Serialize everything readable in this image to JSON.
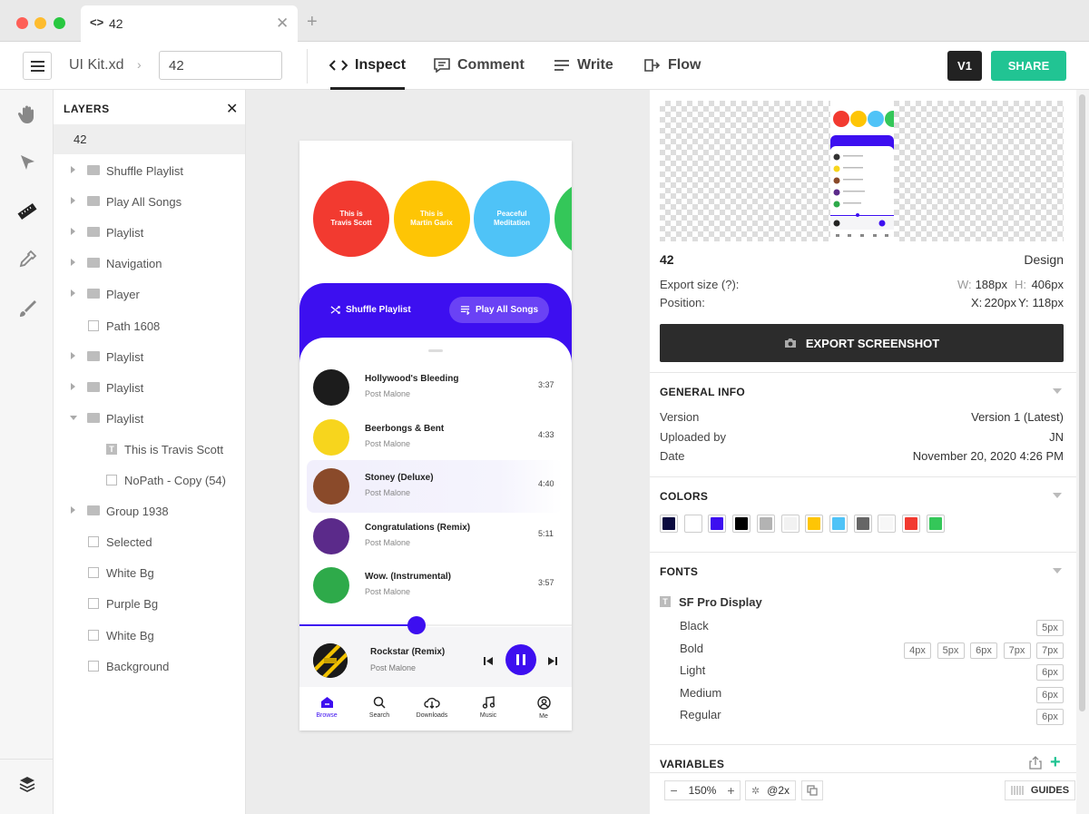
{
  "browser_tab": {
    "title": "42"
  },
  "toolbar": {
    "file_name": "UI Kit.xd",
    "artboard_value": "42",
    "nav": [
      "Inspect",
      "Comment",
      "Write",
      "Flow"
    ],
    "version": "V1",
    "share": "SHARE"
  },
  "layers": {
    "title": "LAYERS",
    "root": "42",
    "items": [
      {
        "label": "Shuffle Playlist",
        "type": "folder",
        "expand": "collapsed",
        "indent": 0
      },
      {
        "label": "Play All Songs",
        "type": "folder",
        "expand": "collapsed",
        "indent": 0
      },
      {
        "label": "Playlist",
        "type": "folder",
        "expand": "collapsed",
        "indent": 0
      },
      {
        "label": "Navigation",
        "type": "folder",
        "expand": "collapsed",
        "indent": 0
      },
      {
        "label": "Player",
        "type": "folder",
        "expand": "collapsed",
        "indent": 0
      },
      {
        "label": "Path 1608",
        "type": "path",
        "expand": "none",
        "indent": 0
      },
      {
        "label": "Playlist",
        "type": "folder",
        "expand": "collapsed",
        "indent": 0
      },
      {
        "label": "Playlist",
        "type": "folder",
        "expand": "collapsed",
        "indent": 0
      },
      {
        "label": "Playlist",
        "type": "folder",
        "expand": "expanded",
        "indent": 0
      },
      {
        "label": "This is Travis Scott",
        "type": "text",
        "expand": "none",
        "indent": 1
      },
      {
        "label": "NoPath - Copy (54)",
        "type": "path",
        "expand": "none",
        "indent": 1
      },
      {
        "label": "Group 1938",
        "type": "folder",
        "expand": "collapsed",
        "indent": 0
      },
      {
        "label": "Selected",
        "type": "path",
        "expand": "none",
        "indent": 0
      },
      {
        "label": "White Bg",
        "type": "path",
        "expand": "none",
        "indent": 0
      },
      {
        "label": "Purple Bg",
        "type": "path",
        "expand": "none",
        "indent": 0
      },
      {
        "label": "White Bg",
        "type": "path",
        "expand": "none",
        "indent": 0
      },
      {
        "label": "Background",
        "type": "path",
        "expand": "none",
        "indent": 0
      }
    ]
  },
  "phone": {
    "playlists": [
      {
        "label": "This is\nTravis Scott",
        "color": "#f23a30"
      },
      {
        "label": "This is\nMartin Garix",
        "color": "#fec505"
      },
      {
        "label": "Peaceful\nMeditation",
        "color": "#4fc3f7"
      },
      {
        "label": "",
        "color": "#34c759"
      }
    ],
    "shuffle": "Shuffle Playlist",
    "play_all": "Play All Songs",
    "songs": [
      {
        "name": "Hollywood's Bleeding",
        "artist": "Post Malone",
        "duration": "3:37",
        "art": "#1c1c1c",
        "selected": false
      },
      {
        "name": "Beerbongs & Bent",
        "artist": "Post Malone",
        "duration": "4:33",
        "art": "#f7d51d",
        "selected": false
      },
      {
        "name": "Stoney (Deluxe)",
        "artist": "Post Malone",
        "duration": "4:40",
        "art": "#8a4a2a",
        "selected": true
      },
      {
        "name": "Congratulations (Remix)",
        "artist": "Post Malone",
        "duration": "5:11",
        "art": "#5b2a8a",
        "selected": false
      },
      {
        "name": "Wow. (Instrumental)",
        "artist": "Post Malone",
        "duration": "3:57",
        "art": "#2eaa4a",
        "selected": false
      }
    ],
    "progress": 0.43,
    "now_playing": {
      "name": "Rockstar (Remix)",
      "artist": "Post Malone"
    },
    "tabs": [
      "Browse",
      "Search",
      "Downloads",
      "Music",
      "Me"
    ],
    "accent": "#3d0ff0"
  },
  "inspect": {
    "artboard_name": "42",
    "artboard_type": "Design",
    "export_size_label": "Export size (?):",
    "width_label": "W:",
    "width_value": "188px",
    "height_label": "H:",
    "height_value": "406px",
    "position_label": "Position:",
    "x_label": "X:",
    "x_value": "220px",
    "y_label": "Y:",
    "y_value": "118px",
    "export_button": "EXPORT SCREENSHOT",
    "general_info": {
      "title": "GENERAL INFO",
      "rows": [
        {
          "label": "Version",
          "value": "Version 1 (Latest)"
        },
        {
          "label": "Uploaded by",
          "value": "JN"
        },
        {
          "label": "Date",
          "value": "November 20, 2020 4:26 PM"
        }
      ]
    },
    "colors": {
      "title": "COLORS",
      "swatches": [
        "#0b0b40",
        "#ffffff",
        "#3d0ff0",
        "#000000",
        "#b3b3b3",
        "#f2f2f2",
        "#fec505",
        "#4fc3f7",
        "#666666",
        "#f7f7f7",
        "#f23a30",
        "#34c759"
      ]
    },
    "fonts": {
      "title": "FONTS",
      "family": "SF Pro Display",
      "weights": [
        {
          "name": "Black",
          "sizes": [
            "5px"
          ]
        },
        {
          "name": "Bold",
          "sizes": [
            "4px",
            "5px",
            "6px",
            "7px",
            "7px"
          ]
        },
        {
          "name": "Light",
          "sizes": [
            "6px"
          ]
        },
        {
          "name": "Medium",
          "sizes": [
            "6px"
          ]
        },
        {
          "name": "Regular",
          "sizes": [
            "6px"
          ]
        }
      ]
    },
    "variables": {
      "title": "VARIABLES"
    }
  },
  "bottom": {
    "zoom": "150%",
    "scale": "@2x",
    "guides": "GUIDES"
  }
}
